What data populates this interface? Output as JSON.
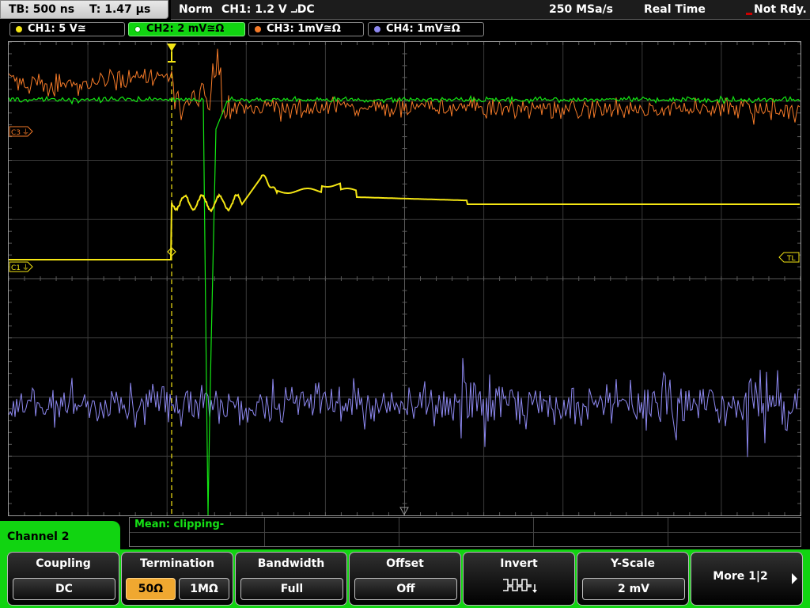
{
  "topbar": {
    "timebase": "TB: 500 ns",
    "trigger_time": "T: 1.47 µs",
    "trigger_mode": "Norm",
    "trigger_source": "CH1: 1.2 V ⨼DC",
    "sample_rate": "250 MSa/s",
    "acq_mode": "Real Time",
    "status": "Not Rdy."
  },
  "channels": [
    {
      "label": "CH1: 5 V≅",
      "color": "#f5e614"
    },
    {
      "label": "CH2: 2 mV≅Ω",
      "color": "#13e813",
      "active": true
    },
    {
      "label": "CH3: 1mV≅Ω",
      "color": "#f57a28"
    },
    {
      "label": "CH4: 1mV≅Ω",
      "color": "#8d88f0"
    }
  ],
  "markers": {
    "ch3_ref": "C3",
    "ch1_ref": "C1",
    "trigger_level": "TL"
  },
  "measurement": {
    "text": "Mean: clipping-"
  },
  "menu": {
    "title": "Channel 2",
    "coupling": {
      "title": "Coupling",
      "value": "DC"
    },
    "termination": {
      "title": "Termination",
      "opt1": "50Ω",
      "opt2": "1MΩ",
      "selected": "50Ω"
    },
    "bandwidth": {
      "title": "Bandwidth",
      "value": "Full"
    },
    "offset": {
      "title": "Offset",
      "value": "Off"
    },
    "invert": {
      "title": "Invert",
      "icon": "invert-waveform-icon"
    },
    "yscale": {
      "title": "Y-Scale",
      "value": "2 mV"
    },
    "more": {
      "label": "More 1|2"
    }
  },
  "colors": {
    "ch1": "#f5e614",
    "ch2": "#13e813",
    "ch3": "#f57a28",
    "ch4": "#8d88f0",
    "menu_bg": "#11d411",
    "selected_option": "#f0a830"
  }
}
